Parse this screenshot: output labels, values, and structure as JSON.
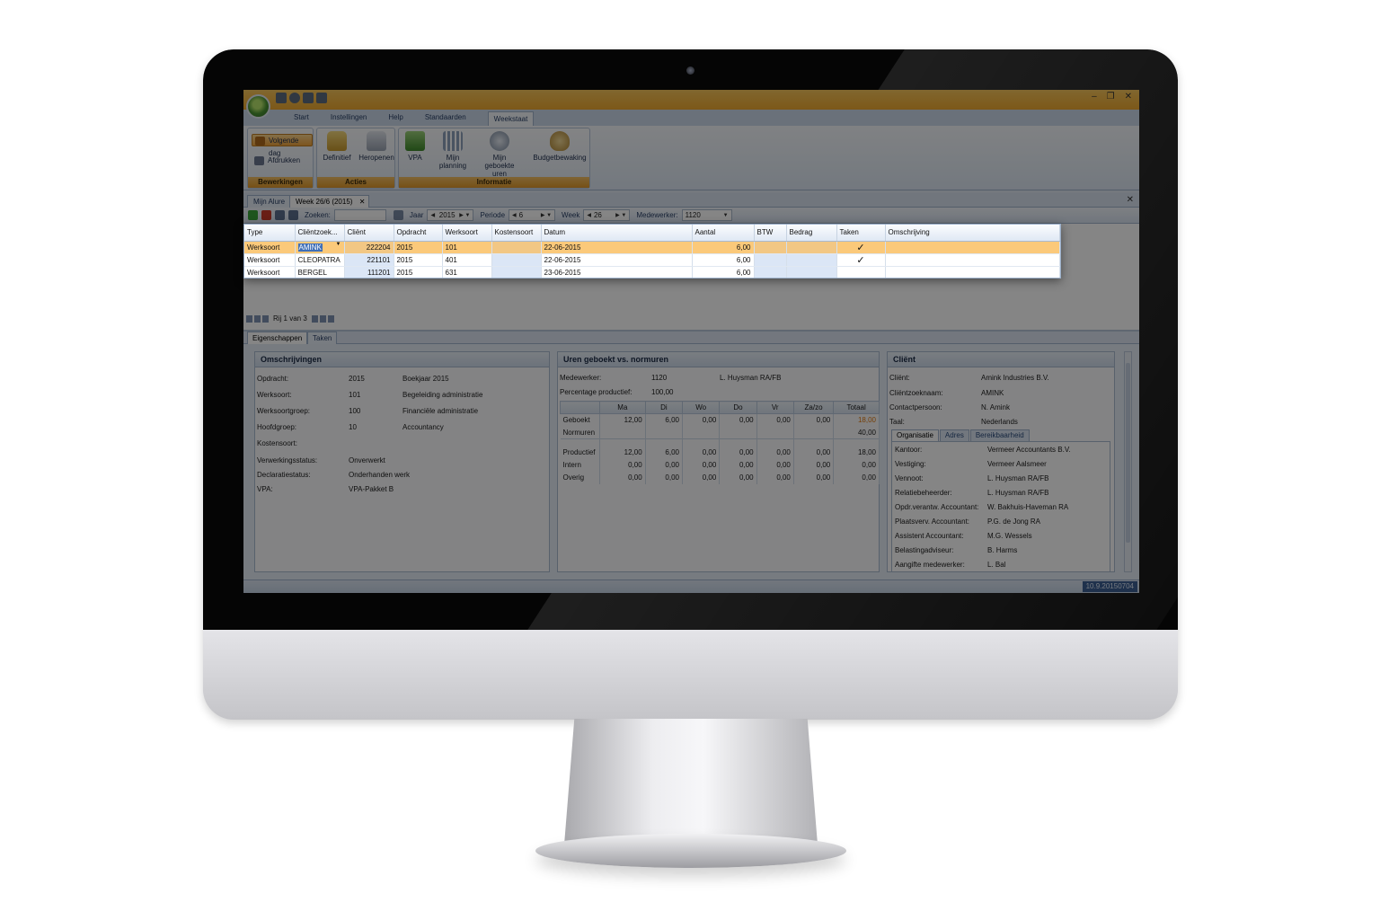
{
  "window": {
    "tabs": [
      "Start",
      "Instellingen",
      "Help",
      "Standaarden",
      "Weekstaat"
    ],
    "active_tab": "Weekstaat",
    "controls": {
      "minimize": "–",
      "restore": "❐",
      "close": "✕"
    }
  },
  "ribbon": {
    "bewerkingen": {
      "label": "Bewerkingen",
      "next_day": "Volgende dag",
      "print": "Afdrukken"
    },
    "acties": {
      "label": "Acties",
      "definitief": "Definitief",
      "heropenen": "Heropenen"
    },
    "informatie": {
      "label": "Informatie",
      "vpa": "VPA",
      "mijn_planning": "Mijn planning",
      "mijn_geboekte_uren": "Mijn geboekte uren",
      "budgetbewaking": "Budgetbewaking"
    }
  },
  "doc_tabs": {
    "tab1": "Mijn Alure",
    "tab2": "Week 26/6 (2015)",
    "close": "✕"
  },
  "toolbar": {
    "search_label": "Zoeken:",
    "year_label": "Jaar",
    "year_value": "2015",
    "period_label": "Periode",
    "period_value": "6",
    "week_label": "Week",
    "week_value": "26",
    "employee_label": "Medewerker:",
    "employee_value": "1120"
  },
  "grid": {
    "columns": [
      "Type",
      "Cliëntzoek...",
      "Cliënt",
      "Opdracht",
      "Werksoort",
      "Kostensoort",
      "Datum",
      "Aantal",
      "BTW",
      "Bedrag",
      "Taken",
      "Omschrijving"
    ],
    "rows": [
      {
        "type": "Werksoort",
        "zoek": "AMINK",
        "client": "222204",
        "opdracht": "2015",
        "werksoort": "101",
        "kostensoort": "",
        "datum": "22-06-2015",
        "aantal": "6,00",
        "btw": "",
        "bedrag": "",
        "taken": "✓",
        "omschrijving": ""
      },
      {
        "type": "Werksoort",
        "zoek": "CLEOPATRA",
        "client": "221101",
        "opdracht": "2015",
        "werksoort": "401",
        "kostensoort": "",
        "datum": "22-06-2015",
        "aantal": "6,00",
        "btw": "",
        "bedrag": "",
        "taken": "✓",
        "omschrijving": ""
      },
      {
        "type": "Werksoort",
        "zoek": "BERGEL",
        "client": "111201",
        "opdracht": "2015",
        "werksoort": "631",
        "kostensoort": "",
        "datum": "23-06-2015",
        "aantal": "6,00",
        "btw": "",
        "bedrag": "",
        "taken": "",
        "omschrijving": ""
      }
    ],
    "pager": "Rij 1 van 3"
  },
  "props_tabs": {
    "tab1": "Eigenschappen",
    "tab2": "Taken"
  },
  "omschrijvingen": {
    "title": "Omschrijvingen",
    "rows": [
      {
        "label": "Opdracht:",
        "code": "2015",
        "desc": "Boekjaar 2015"
      },
      {
        "label": "Werksoort:",
        "code": "101",
        "desc": "Begeleiding administratie"
      },
      {
        "label": "Werksoortgroep:",
        "code": "100",
        "desc": "Financiële administratie"
      },
      {
        "label": "Hoofdgroep:",
        "code": "10",
        "desc": "Accountancy"
      },
      {
        "label": "Kostensoort:",
        "code": "",
        "desc": ""
      }
    ],
    "status_rows": [
      {
        "label": "Verwerkingsstatus:",
        "value": "Onverwerkt"
      },
      {
        "label": "Declaratiestatus:",
        "value": "Onderhanden werk"
      },
      {
        "label": "VPA:",
        "value": "VPA-Pakket B"
      }
    ]
  },
  "uren": {
    "title": "Uren geboekt vs. normuren",
    "medewerker_label": "Medewerker:",
    "medewerker_code": "1120",
    "medewerker_name": "L. Huysman RA/FB",
    "productief_label": "Percentage productief:",
    "productief_value": "100,00",
    "headers": [
      "",
      "Ma",
      "Di",
      "Wo",
      "Do",
      "Vr",
      "Za/zo",
      "Totaal"
    ],
    "rows": [
      [
        "Geboekt",
        "12,00",
        "6,00",
        "0,00",
        "0,00",
        "0,00",
        "0,00",
        "18,00"
      ],
      [
        "Normuren",
        "",
        "",
        "",
        "",
        "",
        "",
        "40,00"
      ],
      [
        "Productief",
        "12,00",
        "6,00",
        "0,00",
        "0,00",
        "0,00",
        "0,00",
        "18,00"
      ],
      [
        "Intern",
        "0,00",
        "0,00",
        "0,00",
        "0,00",
        "0,00",
        "0,00",
        "0,00"
      ],
      [
        "Overig",
        "0,00",
        "0,00",
        "0,00",
        "0,00",
        "0,00",
        "0,00",
        "0,00"
      ]
    ],
    "highlight_color": "#e07a10"
  },
  "client": {
    "title": "Cliënt",
    "rows": [
      {
        "label": "Cliënt:",
        "value": "Amink Industries B.V."
      },
      {
        "label": "Cliëntzoeknaam:",
        "value": "AMINK"
      },
      {
        "label": "Contactpersoon:",
        "value": "N. Amink"
      },
      {
        "label": "Taal:",
        "value": "Nederlands"
      }
    ],
    "subtabs": [
      "Organisatie",
      "Adres",
      "Bereikbaarheid"
    ],
    "org_rows": [
      {
        "label": "Kantoor:",
        "value": "Vermeer Accountants B.V."
      },
      {
        "label": "Vestiging:",
        "value": "Vermeer Aalsmeer"
      },
      {
        "label": "Vennoot:",
        "value": "L. Huysman RA/FB"
      },
      {
        "label": "Relatiebeheerder:",
        "value": "L. Huysman RA/FB"
      },
      {
        "label": "Opdr.verantw. Accountant:",
        "value": "W. Bakhuis-Haveman RA"
      },
      {
        "label": "Plaatsverv. Accountant:",
        "value": "P.G. de Jong RA"
      },
      {
        "label": "Assistent Accountant:",
        "value": "M.G. Wessels"
      },
      {
        "label": "Belastingadviseur:",
        "value": "B. Harms"
      },
      {
        "label": "Aangifte medewerker:",
        "value": "L. Bal"
      }
    ]
  },
  "status": {
    "version": "10.9.20150704"
  },
  "colors": {
    "selected_row": "#fbc97a",
    "ribbon_orange": "#eea92f",
    "accent_blue": "#3d5f92"
  }
}
